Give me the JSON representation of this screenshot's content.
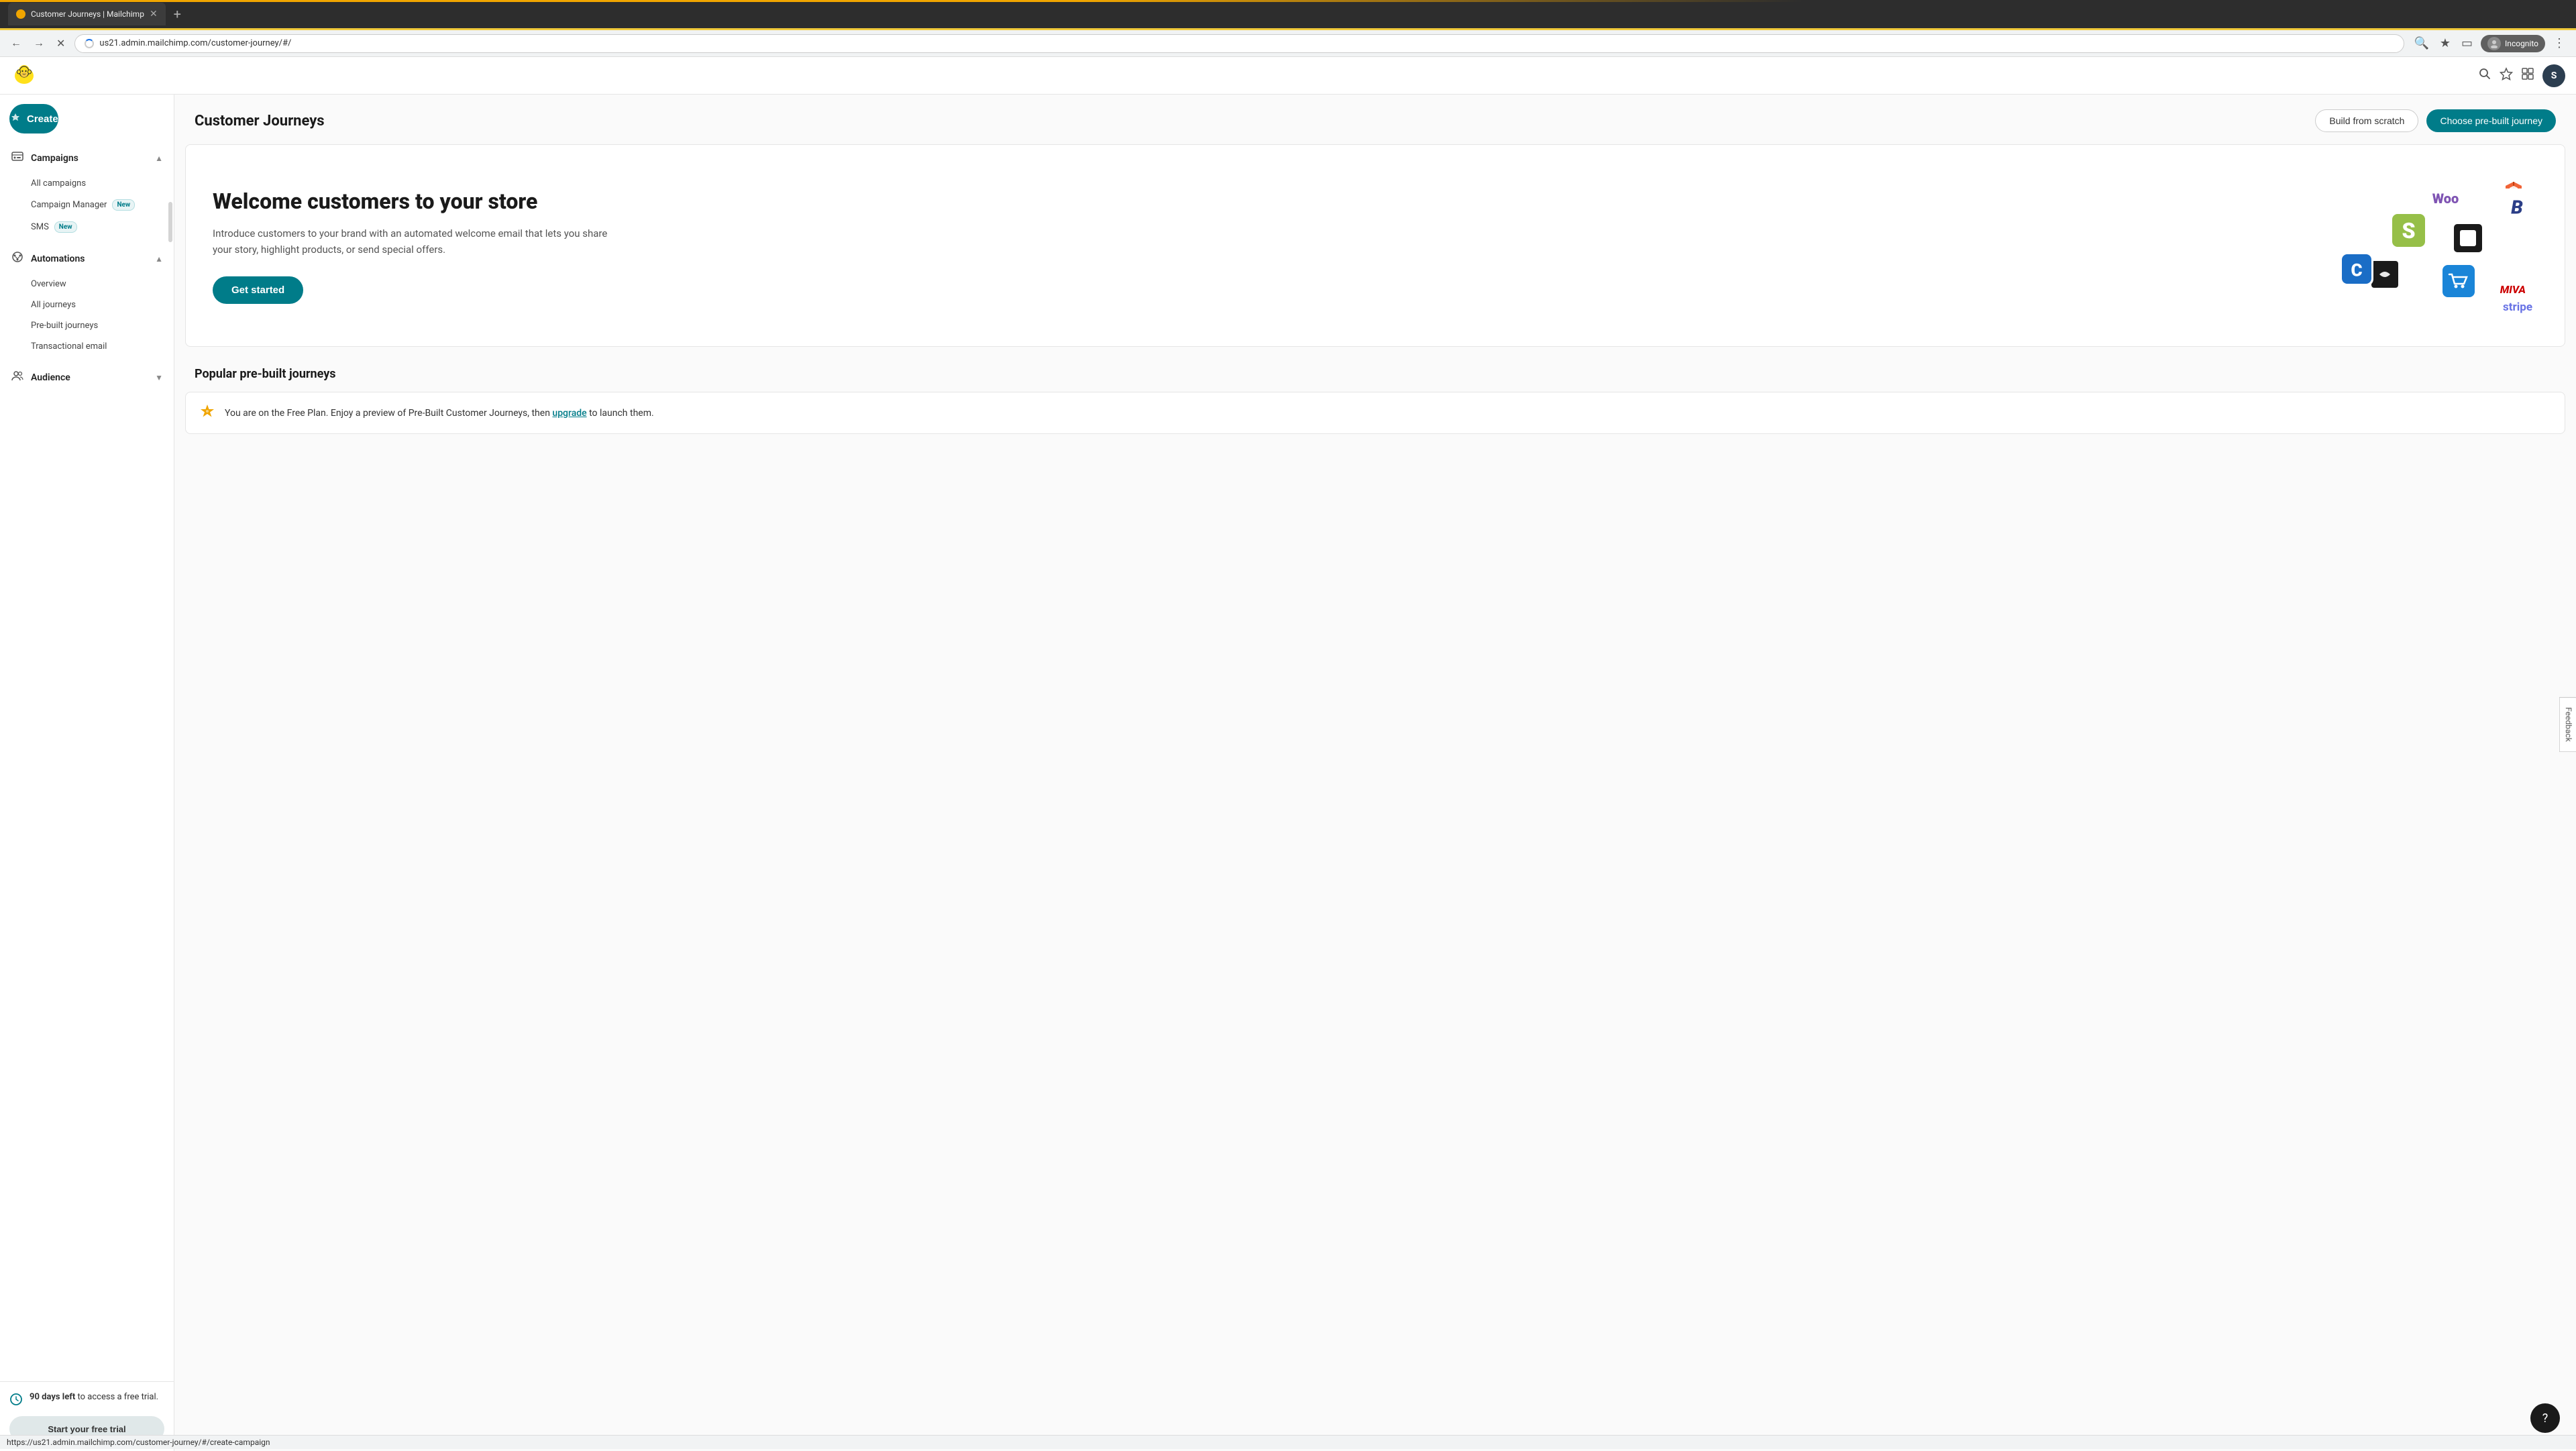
{
  "browser": {
    "tab_title": "Customer Journeys | Mailchimp",
    "url": "us21.admin.mailchimp.com/customer-journey/#/",
    "status_url": "https://us21.admin.mailchimp.com/customer-journey/#/create-campaign",
    "incognito_label": "Incognito"
  },
  "header": {
    "logo_alt": "Mailchimp",
    "user_initial": "S",
    "search_label": "Search",
    "star_label": "Bookmark",
    "layout_label": "Layout"
  },
  "sidebar": {
    "create_btn": "Create",
    "campaigns_label": "Campaigns",
    "campaigns_items": [
      {
        "id": "all-campaigns",
        "label": "All campaigns",
        "badge": ""
      },
      {
        "id": "campaign-manager",
        "label": "Campaign Manager",
        "badge": "New"
      },
      {
        "id": "sms",
        "label": "SMS",
        "badge": "New"
      }
    ],
    "automations_label": "Automations",
    "automations_items": [
      {
        "id": "overview",
        "label": "Overview",
        "badge": ""
      },
      {
        "id": "all-journeys",
        "label": "All journeys",
        "badge": ""
      },
      {
        "id": "pre-built-journeys",
        "label": "Pre-built journeys",
        "badge": ""
      },
      {
        "id": "transactional-email",
        "label": "Transactional email",
        "badge": ""
      }
    ],
    "audience_label": "Audience",
    "trial_days": "90 days left",
    "trial_text": " to access a free trial.",
    "start_trial_btn": "Start your free trial"
  },
  "page": {
    "title": "Customer Journeys",
    "build_from_scratch_btn": "Build from scratch",
    "choose_prebuilt_btn": "Choose pre-built journey"
  },
  "hero": {
    "title": "Welcome customers to your store",
    "description": "Introduce customers to your brand with an automated welcome email that lets you share your story, highlight products, or send special offers.",
    "cta_btn": "Get started"
  },
  "popular_section": {
    "title": "Popular pre-built journeys",
    "notice_text": "You are on the Free Plan. Enjoy a preview of Pre-Built Customer Journeys, then ",
    "upgrade_link": "upgrade",
    "notice_text2": " to launch them."
  },
  "logos": [
    {
      "name": "woocommerce",
      "text": "Woo"
    },
    {
      "name": "shopify",
      "text": "S"
    },
    {
      "name": "square",
      "text": "■"
    },
    {
      "name": "magento",
      "text": "M"
    },
    {
      "name": "squarespace",
      "text": "S"
    },
    {
      "name": "stripe",
      "text": "stripe"
    },
    {
      "name": "miva",
      "text": "MIVA"
    }
  ],
  "feedback": {
    "label": "Feedback"
  },
  "help": {
    "label": "?"
  }
}
